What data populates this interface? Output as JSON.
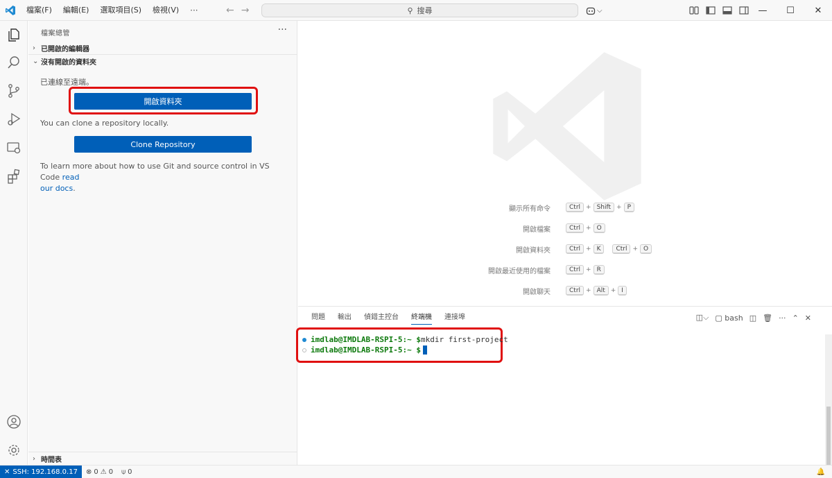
{
  "colors": {
    "accent": "#005fb8",
    "highlight": "#e01010",
    "prompt": "#0e7a0e"
  },
  "titlebar": {
    "menus": [
      "檔案(F)",
      "編輯(E)",
      "選取項目(S)",
      "檢視(V)"
    ],
    "more": "···",
    "search_label": "搜尋"
  },
  "sidebar": {
    "title": "檔案總管",
    "more": "···",
    "open_editors": "已開啟的編輯器",
    "no_folder": "沒有開啟的資料夾",
    "connected_text": "已連線至遠端。",
    "open_folder_button": "開啟資料夾",
    "clone_text": "You can clone a repository locally.",
    "clone_button": "Clone Repository",
    "learn_text_1": "To learn more about how to use Git and source control in VS Code ",
    "learn_link_1": "read",
    "learn_link_2": "our docs",
    "learn_text_2": ".",
    "timeline": "時間表"
  },
  "editor": {
    "shortcuts": [
      {
        "label": "顯示所有命令",
        "keys": [
          "Ctrl",
          "+",
          "Shift",
          "+",
          "P"
        ]
      },
      {
        "label": "開啟檔案",
        "keys": [
          "Ctrl",
          "+",
          "O"
        ]
      },
      {
        "label": "開啟資料夾",
        "keys": [
          "Ctrl",
          "+",
          "K",
          " ",
          "Ctrl",
          "+",
          "O"
        ]
      },
      {
        "label": "開啟最近使用的檔案",
        "keys": [
          "Ctrl",
          "+",
          "R"
        ]
      },
      {
        "label": "開啟聊天",
        "keys": [
          "Ctrl",
          "+",
          "Alt",
          "+",
          "I"
        ]
      }
    ]
  },
  "panel": {
    "tabs": [
      "問題",
      "輸出",
      "偵錯主控台",
      "終端機",
      "連接埠"
    ],
    "active_tab": "終端機",
    "shell": "bash",
    "terminal": [
      {
        "prompt": "imdlab@IMDLAB-RSPI-5",
        "path": ":~ $ ",
        "command": "mkdir first-project",
        "status": "done"
      },
      {
        "prompt": "imdlab@IMDLAB-RSPI-5",
        "path": ":~ $ ",
        "command": "",
        "status": "current"
      }
    ]
  },
  "statusbar": {
    "remote": "SSH: 192.168.0.17",
    "errors": "0",
    "warnings": "0",
    "ports": "0"
  }
}
